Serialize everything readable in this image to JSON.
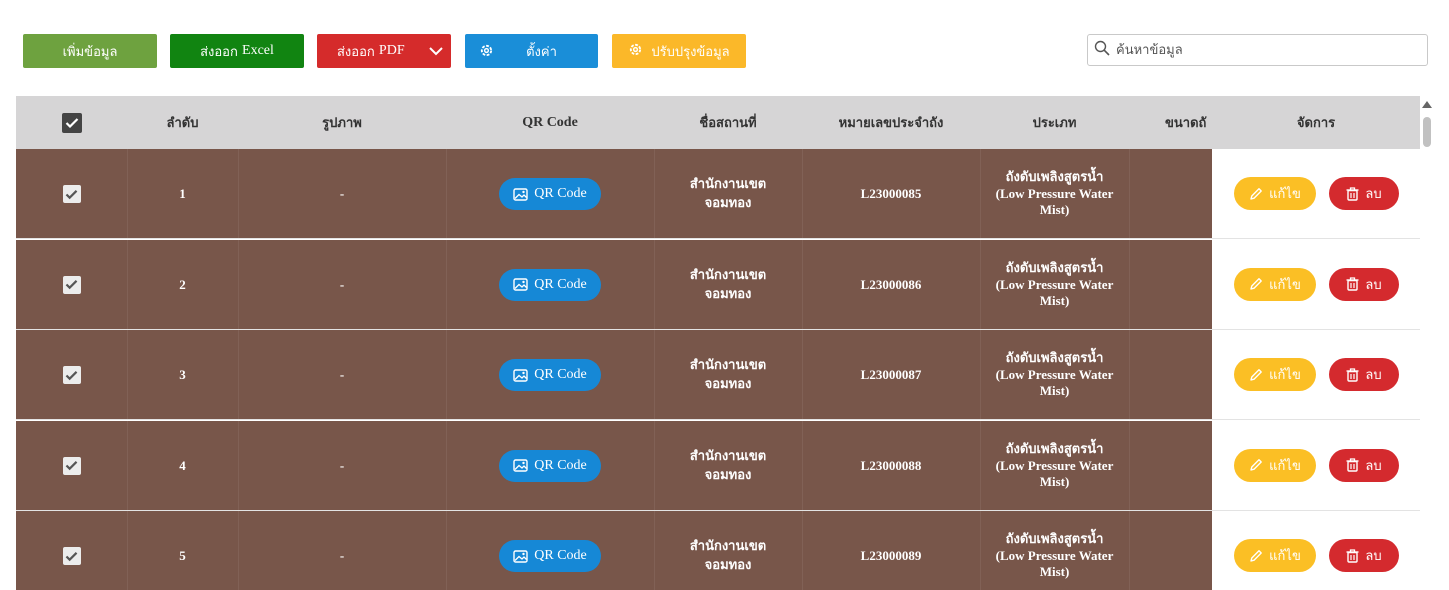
{
  "toolbar": {
    "add_label": "เพิ่มข้อมูล",
    "export_excel_label": "ส่งออก Excel",
    "export_excel_prefix": "ส่งออก",
    "export_excel_suffix": "Excel",
    "export_pdf_prefix": "ส่งออก",
    "export_pdf_suffix": "PDF",
    "settings_label": "ตั้งค่า",
    "update_label": "ปรับปรุงข้อมูล"
  },
  "search": {
    "placeholder": "ค้นหาข้อมูล"
  },
  "table": {
    "headers": {
      "order": "ลำดับ",
      "image": "รูปภาพ",
      "qr": "QR Code",
      "place": "ชื่อสถานที่",
      "tank_no": "หมายเลขประจำถัง",
      "type": "ประเภท",
      "size": "ขนาดถั",
      "manage": "จัดการ"
    },
    "qr_button_label": "QR Code",
    "edit_label": "แก้ไข",
    "delete_label": "ลบ",
    "rows": [
      {
        "order": "1",
        "image": "-",
        "place_l1": "สำนักงานเขต",
        "place_l2": "จอมทอง",
        "tank_no": "L23000085",
        "type_l1": "ถังดับเพลิงสูตรน้ำ",
        "type_l2": "(Low Pressure Water",
        "type_l3": "Mist)"
      },
      {
        "order": "2",
        "image": "-",
        "place_l1": "สำนักงานเขต",
        "place_l2": "จอมทอง",
        "tank_no": "L23000086",
        "type_l1": "ถังดับเพลิงสูตรน้ำ",
        "type_l2": "(Low Pressure Water",
        "type_l3": "Mist)"
      },
      {
        "order": "3",
        "image": "-",
        "place_l1": "สำนักงานเขต",
        "place_l2": "จอมทอง",
        "tank_no": "L23000087",
        "type_l1": "ถังดับเพลิงสูตรน้ำ",
        "type_l2": "(Low Pressure Water",
        "type_l3": "Mist)"
      },
      {
        "order": "4",
        "image": "-",
        "place_l1": "สำนักงานเขต",
        "place_l2": "จอมทอง",
        "tank_no": "L23000088",
        "type_l1": "ถังดับเพลิงสูตรน้ำ",
        "type_l2": "(Low Pressure Water",
        "type_l3": "Mist)"
      },
      {
        "order": "5",
        "image": "-",
        "place_l1": "สำนักงานเขต",
        "place_l2": "จอมทอง",
        "tank_no": "L23000089",
        "type_l1": "ถังดับเพลิงสูตรน้ำ",
        "type_l2": "(Low Pressure Water",
        "type_l3": "Mist)"
      }
    ]
  },
  "colors": {
    "row_bg": "#78564a",
    "header_bg": "#d6d5d6",
    "add": "#6ea23f",
    "excel": "#118411",
    "pdf": "#d52b2b",
    "settings": "#1a8ed8",
    "update": "#fbb829",
    "edit": "#fbbf25",
    "delete": "#d42a2e"
  },
  "icons": {
    "search": "search-icon",
    "settings": "gear-icon",
    "update": "gear-icon",
    "pdf_caret": "chevron-down-icon",
    "qr": "image-icon",
    "edit": "pencil-icon",
    "delete": "trash-icon",
    "checkbox": "checkmark-icon"
  }
}
